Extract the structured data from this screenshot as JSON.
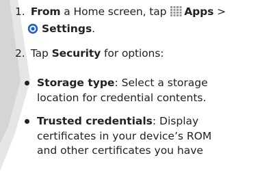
{
  "colors": {
    "text": "#222222",
    "icon_blue": "#1f5fbf",
    "apps_grid": "#999999",
    "watermark": "#d9d9d9"
  },
  "icons": {
    "apps": "apps-grid-icon",
    "settings": "settings-gear-icon"
  },
  "steps": [
    {
      "number": "1.",
      "prefix": "From",
      "text_a": " a Home screen, tap ",
      "apps_label": "Apps",
      "sep": " >",
      "settings_label": "Settings",
      "end": "."
    },
    {
      "number": "2.",
      "prefix": "Tap ",
      "security_label": "Security",
      "suffix": " for options:"
    }
  ],
  "bullets": [
    {
      "title": "Storage type",
      "lines": [
        ": Select a storage",
        "location for credential contents."
      ]
    },
    {
      "title": "Trusted credentials",
      "lines": [
        ": Display",
        "certificates in your device’s ROM",
        "and other certificates you have"
      ]
    }
  ]
}
